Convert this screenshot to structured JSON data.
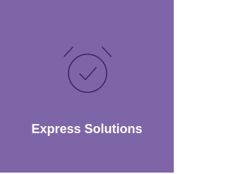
{
  "tile": {
    "label": "Express Solutions",
    "icon": "alarm-clock-check-icon",
    "background_color": "#7e65a8",
    "icon_color": "#3b275f",
    "text_color": "#ffffff"
  }
}
